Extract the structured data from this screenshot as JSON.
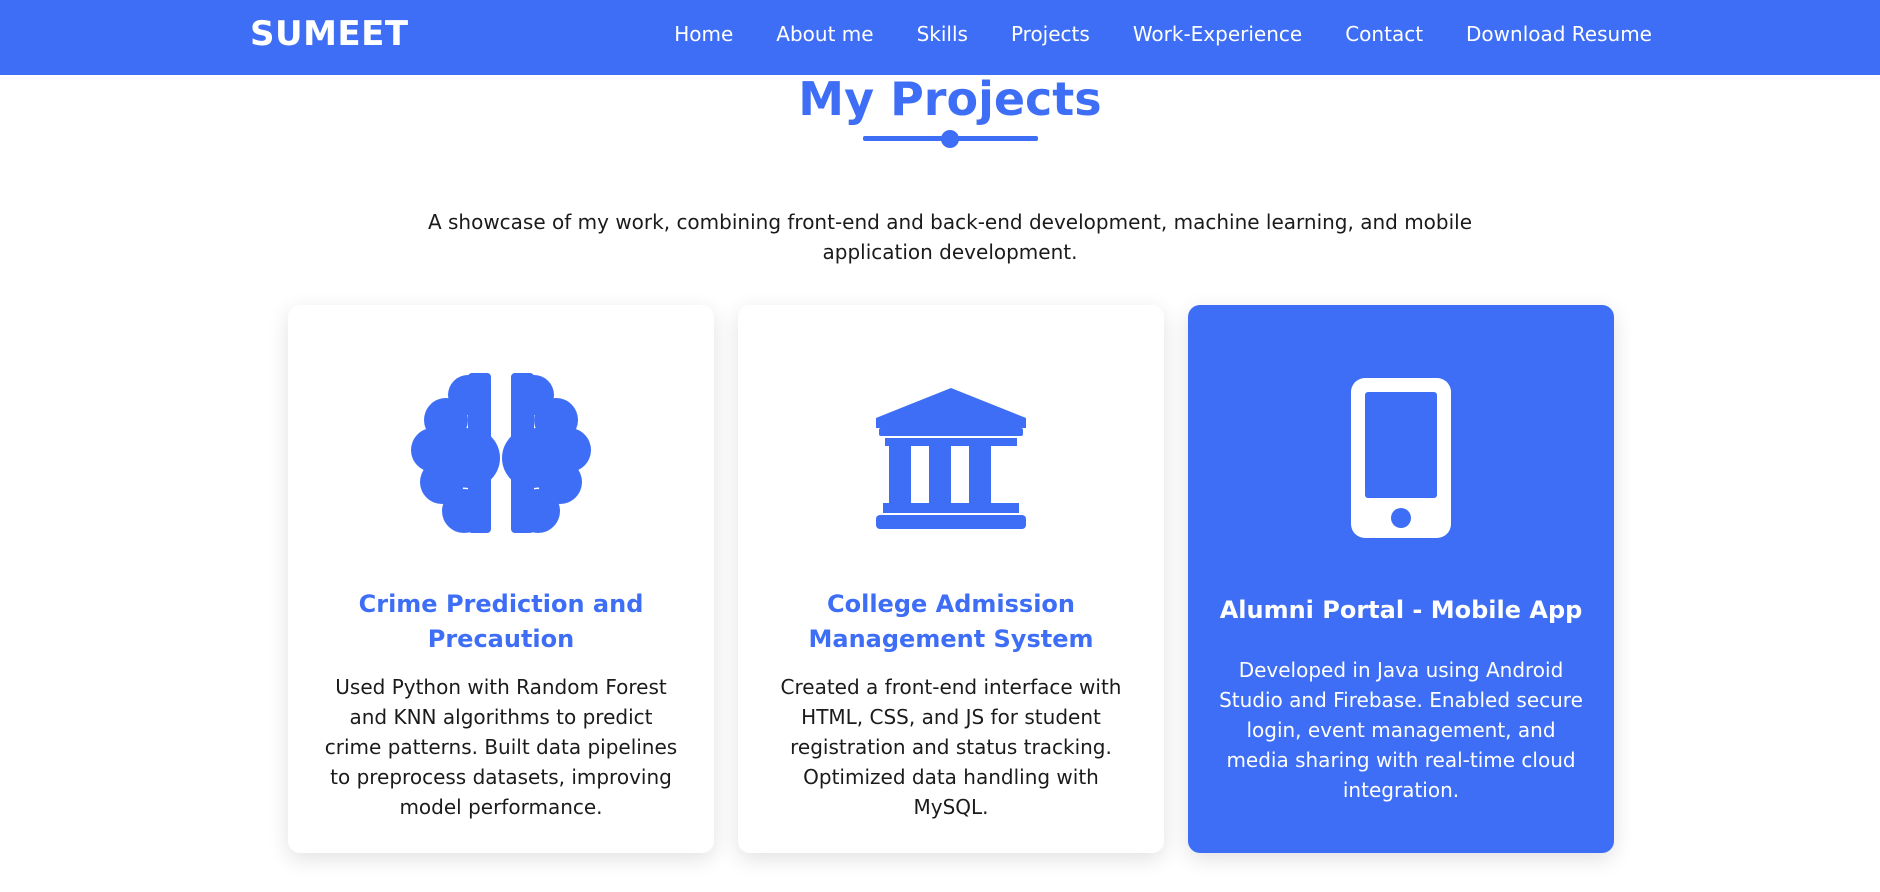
{
  "nav": {
    "brand": "SUMEET",
    "items": [
      {
        "label": "Home"
      },
      {
        "label": "About me"
      },
      {
        "label": "Skills"
      },
      {
        "label": "Projects"
      },
      {
        "label": "Work-Experience"
      },
      {
        "label": "Contact"
      },
      {
        "label": "Download Resume"
      }
    ]
  },
  "section": {
    "title": "My Projects",
    "subtitle": "A showcase of my work, combining front-end and back-end development, machine learning, and mobile application development."
  },
  "projects": [
    {
      "icon": "brain-icon",
      "title": "Crime Prediction and Precaution",
      "description": "Used Python with Random Forest and KNN algorithms to predict crime patterns. Built data pipelines to preprocess datasets, improving model performance."
    },
    {
      "icon": "university-building-icon",
      "title": "College Admission Management System",
      "description": "Created a front-end interface with HTML, CSS, and JS for student registration and status tracking. Optimized data handling with MySQL."
    },
    {
      "icon": "mobile-phone-icon",
      "title": "Alumni Portal - Mobile App",
      "description": "Developed in Java using Android Studio and Firebase. Enabled secure login, event management, and media sharing with real-time cloud integration."
    }
  ],
  "colors": {
    "primary": "#3d6ef5",
    "text": "#1b1b1b",
    "background": "#ffffff"
  }
}
